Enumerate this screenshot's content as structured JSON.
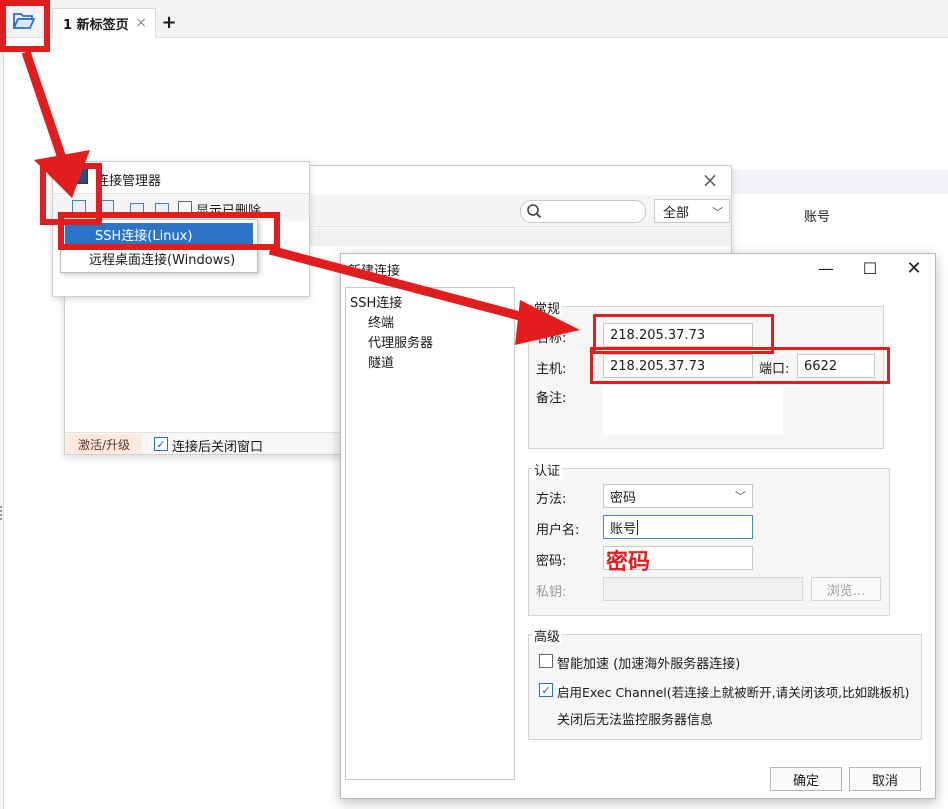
{
  "tabbar": {
    "tab_label": "1 新标签页",
    "tab_close": "×",
    "new_tab": "+"
  },
  "conn_manager": {
    "title": "连接管理器",
    "show_deleted": "显示已删除",
    "filter_value": "全部",
    "bg_column": "账号",
    "activate": "激活/升级",
    "close_after_connect": "连接后关闭窗口",
    "close": "×"
  },
  "context_menu": {
    "items": [
      "SSH连接(Linux)",
      "远程桌面连接(Windows)"
    ]
  },
  "dialog": {
    "title": "新建连接",
    "nav": {
      "root": "SSH连接",
      "children": [
        "终端",
        "代理服务器",
        "隧道"
      ]
    },
    "general": {
      "title": "常规",
      "name_label": "名称:",
      "name_value": "218.205.37.73",
      "host_label": "主机:",
      "host_value": "218.205.37.73",
      "port_label": "端口:",
      "port_value": "6622",
      "note_label": "备注:"
    },
    "auth": {
      "title": "认证",
      "method_label": "方法:",
      "method_value": "密码",
      "user_label": "用户名:",
      "user_value": "账号",
      "pwd_label": "密码:",
      "pwd_annotation": "密码",
      "key_label": "私钥:",
      "browse": "浏览..."
    },
    "advanced": {
      "title": "高级",
      "accel": "智能加速 (加速海外服务器连接)",
      "exec": "启用Exec Channel(若连接上就被断开,请关闭该项,比如跳板机)",
      "exec_note": "关闭后无法监控服务器信息"
    },
    "ok": "确定",
    "cancel": "取消"
  },
  "colors": {
    "annotation_red": "#e21d1d",
    "selection_blue": "#2e74c6"
  }
}
